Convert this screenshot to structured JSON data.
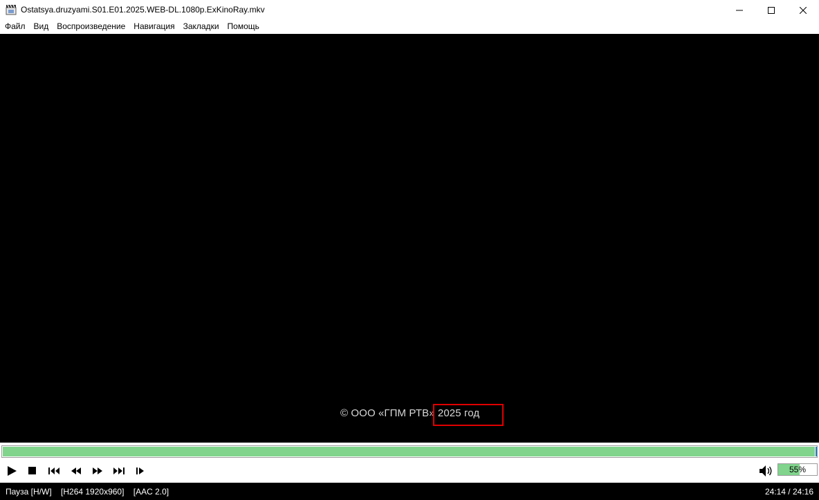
{
  "window": {
    "title": "Ostatsya.druzyami.S01.E01.2025.WEB-DL.1080p.ExKinoRay.mkv",
    "icon": "film-clapper-icon",
    "controls": [
      "minimize-icon",
      "maximize-icon",
      "close-icon"
    ]
  },
  "menu": {
    "items": [
      "Файл",
      "Вид",
      "Воспроизведение",
      "Навигация",
      "Закладки",
      "Помощь"
    ]
  },
  "video": {
    "caption_prefix": "© ООО «ГПМ РТВ»",
    "caption_highlight": "2025 год",
    "highlight_color": "#e00000",
    "background": "#000000"
  },
  "seek": {
    "progress_fraction": 0.998,
    "fill_color": "#80d48c"
  },
  "controls": {
    "buttons": [
      "play-icon",
      "stop-icon",
      "skip-previous-icon",
      "rewind-icon",
      "fast-forward-icon",
      "skip-next-icon",
      "frame-step-icon"
    ],
    "volume_icon": "speaker-icon",
    "volume_label": "55%",
    "volume_fraction": 0.55
  },
  "status": {
    "state": "Пауза [H/W]",
    "video_codec": "[H264 1920x960]",
    "audio_codec": "[AAC 2.0]",
    "time": "24:14 / 24:16"
  }
}
